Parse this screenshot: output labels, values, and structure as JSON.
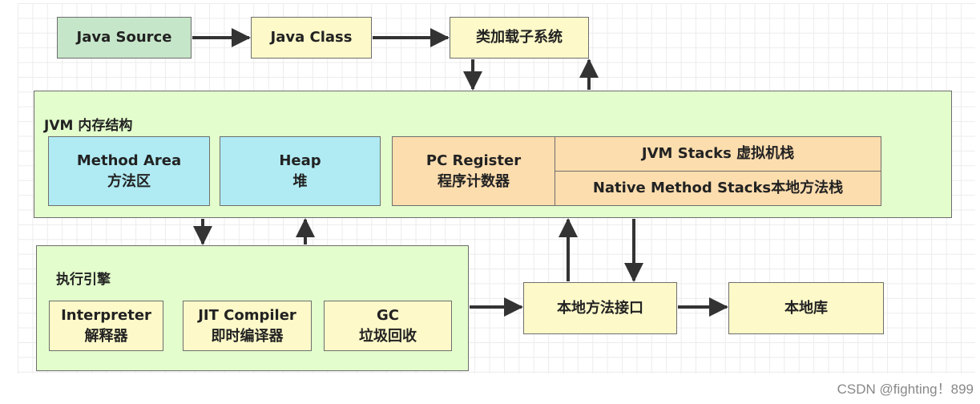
{
  "nodes": {
    "java_source": "Java Source",
    "java_class": "Java Class",
    "class_loader": "类加载子系统",
    "jvm_memory_title": "JVM 内存结构",
    "method_area": {
      "en": "Method Area",
      "zh": "方法区"
    },
    "heap": {
      "en": "Heap",
      "zh": "堆"
    },
    "pc_register": {
      "en": "PC Register",
      "zh": "程序计数器"
    },
    "jvm_stacks": "JVM Stacks 虚拟机栈",
    "native_method_stacks": "Native Method Stacks本地方法栈",
    "execution_engine_title": "执行引擎",
    "interpreter": {
      "en": "Interpreter",
      "zh": "解释器"
    },
    "jit_compiler": {
      "en": "JIT Compiler",
      "zh": "即时编译器"
    },
    "gc": {
      "en": "GC",
      "zh": "垃圾回收"
    },
    "native_interface": "本地方法接口",
    "native_library": "本地库"
  },
  "colors": {
    "source": "#c6e6c9",
    "yellow": "#fdf9c9",
    "memory": "#e3fdcc",
    "blue": "#b0ebf3",
    "orange": "#fcddae"
  },
  "watermark": "CSDN @fighting！899"
}
